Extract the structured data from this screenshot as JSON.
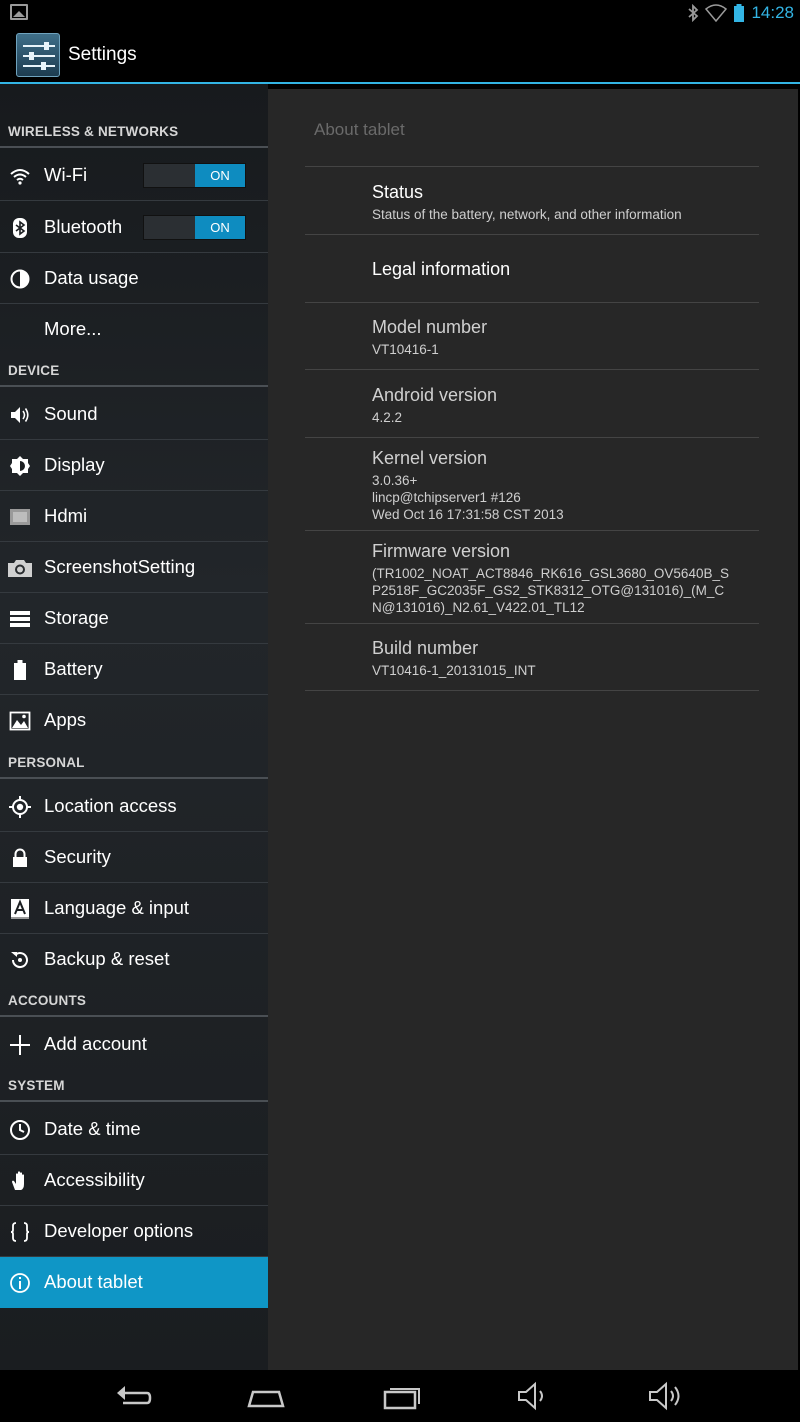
{
  "status_bar": {
    "time": "14:28"
  },
  "action_bar": {
    "title": "Settings"
  },
  "sidebar": {
    "sections": [
      {
        "label": "WIRELESS & NETWORKS"
      },
      {
        "label": "DEVICE"
      },
      {
        "label": "PERSONAL"
      },
      {
        "label": "ACCOUNTS"
      },
      {
        "label": "SYSTEM"
      }
    ],
    "items": [
      {
        "label": "Wi-Fi",
        "toggle": "ON"
      },
      {
        "label": "Bluetooth",
        "toggle": "ON"
      },
      {
        "label": "Data usage"
      },
      {
        "label": "More..."
      },
      {
        "label": "Sound"
      },
      {
        "label": "Display"
      },
      {
        "label": "Hdmi"
      },
      {
        "label": "ScreenshotSetting"
      },
      {
        "label": "Storage"
      },
      {
        "label": "Battery"
      },
      {
        "label": "Apps"
      },
      {
        "label": "Location access"
      },
      {
        "label": "Security"
      },
      {
        "label": "Language & input"
      },
      {
        "label": "Backup & reset"
      },
      {
        "label": "Add account"
      },
      {
        "label": "Date & time"
      },
      {
        "label": "Accessibility"
      },
      {
        "label": "Developer options"
      },
      {
        "label": "About tablet",
        "selected": true
      }
    ]
  },
  "detail": {
    "header": "About tablet",
    "entries": [
      {
        "title": "Status",
        "lines": [
          "Status of the battery, network, and other information"
        ]
      },
      {
        "title": "Legal information",
        "lines": []
      },
      {
        "title": "Model number",
        "lines": [
          "VT10416-1"
        ]
      },
      {
        "title": "Android version",
        "lines": [
          "4.2.2"
        ]
      },
      {
        "title": "Kernel version",
        "lines": [
          "3.0.36+",
          "lincp@tchipserver1 #126",
          "Wed Oct 16 17:31:58 CST 2013"
        ]
      },
      {
        "title": "Firmware version",
        "lines": [
          "(TR1002_NOAT_ACT8846_RK616_GSL3680_OV5640B_S",
          "P2518F_GC2035F_GS2_STK8312_OTG@131016)_(M_C",
          "N@131016)_N2.61_V422.01_TL12"
        ]
      },
      {
        "title": "Build number",
        "lines": [
          "VT10416-1_20131015_INT"
        ]
      }
    ]
  },
  "colors": {
    "accent": "#33b5e5",
    "selected": "#0f96c6",
    "toggle_on": "#0e8cc0"
  }
}
